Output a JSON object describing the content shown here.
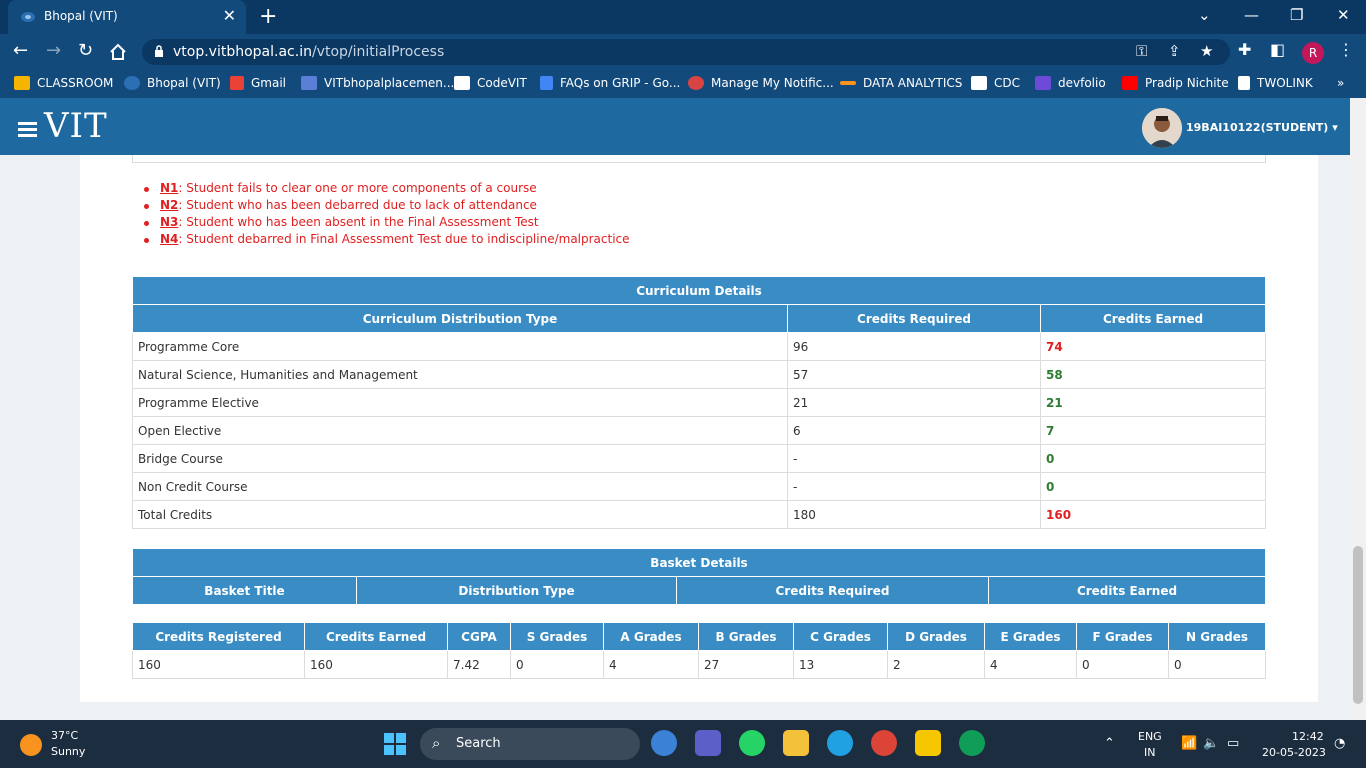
{
  "browser": {
    "tab_title": "Bhopal (VIT)",
    "url_domain": "vtop.vitbhopal.ac.in",
    "url_path": "/vtop/initialProcess",
    "profile_initial": "R",
    "bookmarks": [
      "CLASSROOM",
      "Bhopal (VIT)",
      "Gmail",
      "VITbhopalplacemen...",
      "CodeVIT",
      "FAQs on GRIP - Go...",
      "Manage My Notific...",
      "DATA ANALYTICS",
      "CDC",
      "devfolio",
      "Pradip Nichite",
      "TWOLINK"
    ]
  },
  "header": {
    "logo": "VIT",
    "user": "19BAI10122(STUDENT)"
  },
  "notes": [
    {
      "code": "N1",
      "text": ": Student fails to clear one or more components of a course"
    },
    {
      "code": "N2",
      "text": ": Student who has been debarred due to lack of attendance"
    },
    {
      "code": "N3",
      "text": ": Student who has been absent in the Final Assessment Test"
    },
    {
      "code": "N4",
      "text": ": Student debarred in Final Assessment Test due to indiscipline/malpractice"
    }
  ],
  "curriculum": {
    "title": "Curriculum Details",
    "headers": [
      "Curriculum Distribution Type",
      "Credits Required",
      "Credits Earned"
    ],
    "rows": [
      {
        "type": "Programme Core",
        "required": "96",
        "earned": "74",
        "status": "red"
      },
      {
        "type": "Natural Science, Humanities and Management",
        "required": "57",
        "earned": "58",
        "status": "green"
      },
      {
        "type": "Programme Elective",
        "required": "21",
        "earned": "21",
        "status": "green"
      },
      {
        "type": "Open Elective",
        "required": "6",
        "earned": "7",
        "status": "green"
      },
      {
        "type": "Bridge Course",
        "required": "-",
        "earned": "0",
        "status": "green"
      },
      {
        "type": "Non Credit Course",
        "required": "-",
        "earned": "0",
        "status": "green"
      },
      {
        "type": "Total Credits",
        "required": "180",
        "earned": "160",
        "status": "red"
      }
    ]
  },
  "basket": {
    "title": "Basket Details",
    "headers": [
      "Basket Title",
      "Distribution Type",
      "Credits Required",
      "Credits Earned"
    ]
  },
  "grades": {
    "headers": [
      "Credits Registered",
      "Credits Earned",
      "CGPA",
      "S Grades",
      "A Grades",
      "B Grades",
      "C Grades",
      "D Grades",
      "E Grades",
      "F Grades",
      "N Grades"
    ],
    "values": [
      "160",
      "160",
      "7.42",
      "0",
      "4",
      "27",
      "13",
      "2",
      "4",
      "0",
      "0"
    ]
  },
  "taskbar": {
    "temperature": "37°C",
    "condition": "Sunny",
    "search": "Search",
    "lang1": "ENG",
    "lang2": "IN",
    "time": "12:42",
    "date": "20-05-2023"
  },
  "colors": {
    "header_blue": "#1e6aa0",
    "table_header": "#3a8cc4",
    "status_red": "#e02020",
    "status_green": "#2e7d32"
  }
}
